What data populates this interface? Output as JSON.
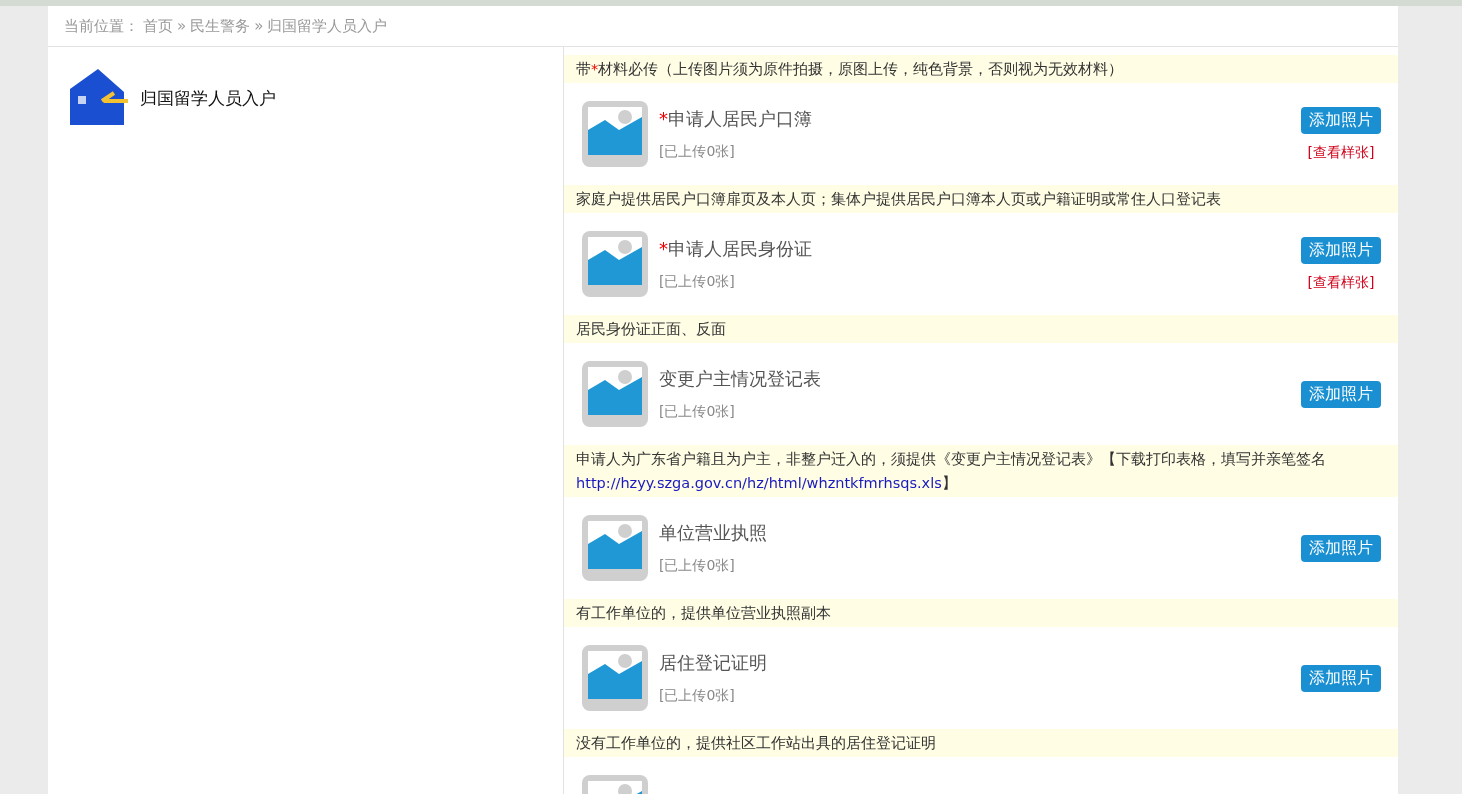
{
  "breadcrumb": {
    "label": "当前位置：",
    "path": [
      "首页",
      "民生警务",
      "归国留学人员入户"
    ],
    "separator": "»"
  },
  "service": {
    "title": "归国留学人员入户"
  },
  "notice": {
    "before": "带",
    "mark": "*",
    "after": "材料必传（上传图片须为原件拍摄，原图上传，纯色背景，否则视为无效材料）"
  },
  "materials": [
    {
      "kind": "item",
      "title": "申请人居民户口簿",
      "required": true,
      "count": "[已上传0张]",
      "button": "添加照片",
      "sample": "[查看样张]",
      "note": {
        "text": "家庭户提供居民户口簿扉页及本人页；集体户提供居民户口簿本人页或户籍证明或常住人口登记表"
      }
    },
    {
      "kind": "item",
      "title": "申请人居民身份证",
      "required": true,
      "count": "[已上传0张]",
      "button": "添加照片",
      "sample": "[查看样张]",
      "note": {
        "text": "居民身份证正面、反面"
      }
    },
    {
      "kind": "item",
      "title": "变更户主情况登记表",
      "required": false,
      "count": "[已上传0张]",
      "button": "添加照片",
      "note": {
        "text": "申请人为广东省户籍且为户主，非整户迁入的，须提供《变更户主情况登记表》【下载打印表格，填写并亲笔签名",
        "link": "http://hzyy.szga.gov.cn/hz/html/whzntkfmrhsqs.xls",
        "suffix": "】"
      }
    },
    {
      "kind": "item",
      "title": "单位营业执照",
      "required": false,
      "count": "[已上传0张]",
      "button": "添加照片",
      "note": {
        "text": "有工作单位的，提供单位营业执照副本"
      }
    },
    {
      "kind": "item",
      "title": "居住登记证明",
      "required": false,
      "count": "[已上传0张]",
      "button": "添加照片",
      "note": {
        "text": "没有工作单位的，提供社区工作站出具的居住登记证明"
      }
    },
    {
      "kind": "partial"
    }
  ]
}
